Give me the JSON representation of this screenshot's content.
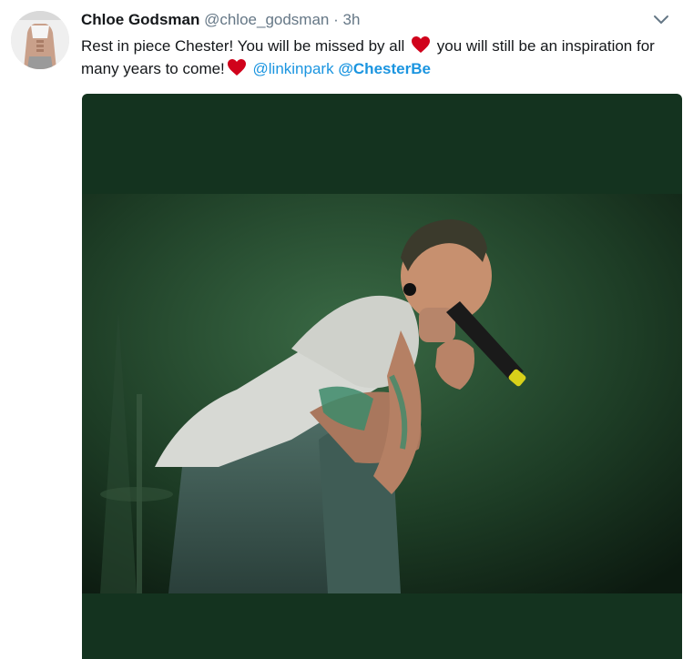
{
  "tweet": {
    "author_name": "Chloe Godsman",
    "author_handle": "@chloe_godsman",
    "separator": "·",
    "time": "3h",
    "text_part1": "Rest in piece Chester! You will be missed by all",
    "text_part2": "you will still be an inspiration for many years to come!",
    "mention1": "@linkinpark",
    "mention2": "@ChesterBe"
  },
  "icons": {
    "menu": "chevron-down-icon",
    "emoji": "red-heart-icon"
  },
  "colors": {
    "name": "#14171a",
    "meta": "#657786",
    "link": "#1b95e0",
    "heart": "#d0021b",
    "media_bg": "#14331f"
  }
}
